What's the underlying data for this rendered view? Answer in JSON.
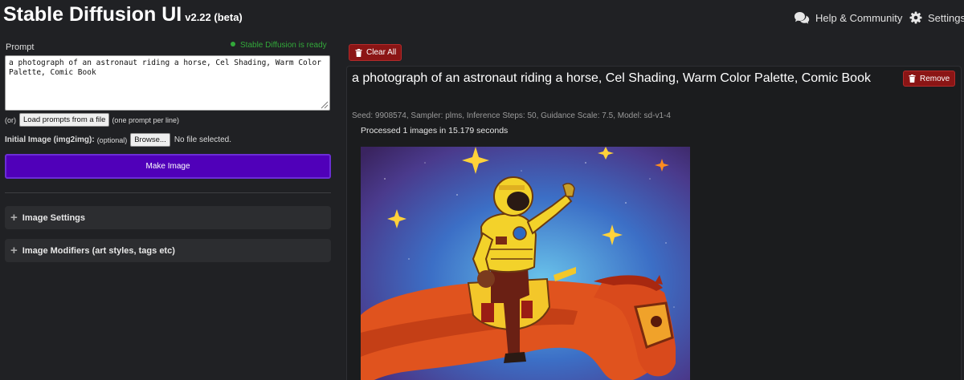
{
  "header": {
    "title": "Stable Diffusion UI",
    "version": "v2.22 (beta)",
    "help_label": "Help & Community",
    "settings_label": "Settings"
  },
  "editor": {
    "prompt_label": "Prompt",
    "status": "Stable Diffusion is ready",
    "prompt_value": "a photograph of an astronaut riding a horse, Cel Shading, Warm Color Palette, Comic Book",
    "load_prefix": "(or)",
    "load_button": "Load prompts from a file",
    "load_suffix": "(one prompt per line)",
    "init_image_label": "Initial Image (img2img):",
    "init_image_optional": "(optional)",
    "browse_button": "Browse...",
    "no_file": "No file selected.",
    "make_button": "Make Image",
    "panels": [
      {
        "label": "Image Settings"
      },
      {
        "label": "Image Modifiers (art styles, tags etc)"
      }
    ]
  },
  "preview": {
    "clear_all": "Clear All",
    "task": {
      "prompt": "a photograph of an astronaut riding a horse, Cel Shading, Warm Color Palette, Comic Book",
      "remove": "Remove",
      "meta": "Seed: 9908574, Sampler: plms, Inference Steps: 50, Guidance Scale: 7.5, Model: sd-v1-4",
      "processed": "Processed 1 images in 15.179 seconds"
    }
  },
  "colors": {
    "background": "#202124",
    "accent_make": "#5000b9",
    "danger": "#8b1515",
    "status_ok": "#32a83a"
  },
  "icons": {
    "help": "chat-bubbles-icon",
    "settings": "gear-icon",
    "clear": "trash-icon",
    "remove": "trash-icon",
    "panel": "plus-icon"
  }
}
